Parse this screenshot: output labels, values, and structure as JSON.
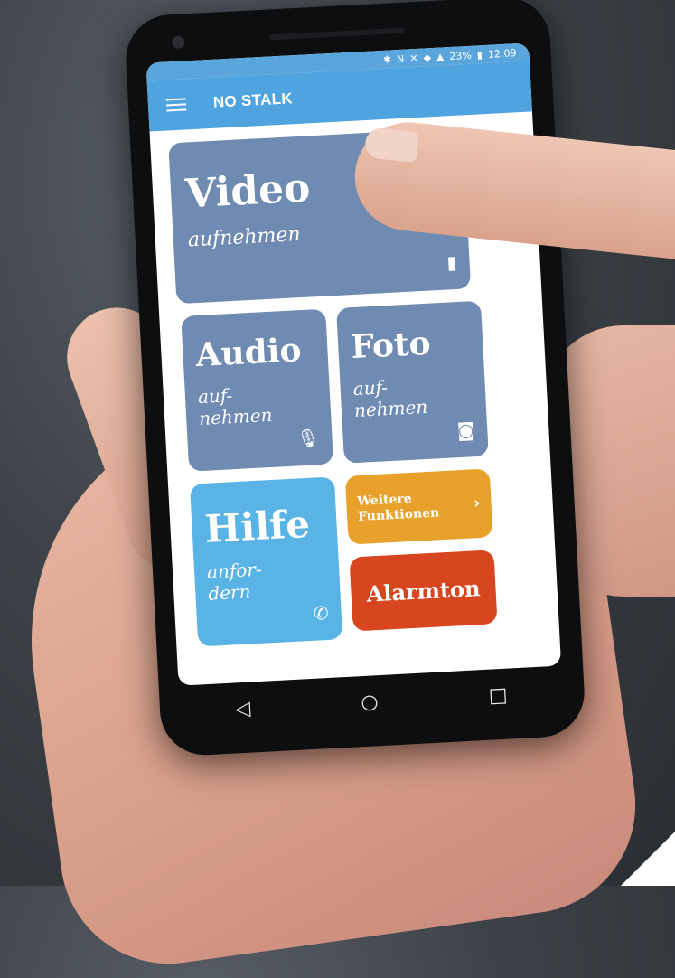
{
  "statusbar": {
    "icons": [
      "bluetooth-icon",
      "nfc-icon",
      "mute-icon",
      "wifi-icon",
      "signal-icon",
      "battery-icon"
    ],
    "battery": "23%",
    "time": "12:09"
  },
  "app": {
    "title": "NO STALK"
  },
  "tiles": {
    "video": {
      "title": "Video",
      "subtitle": "aufnehmen"
    },
    "audio": {
      "title": "Audio",
      "subtitle_line1": "auf-",
      "subtitle_line2": "nehmen"
    },
    "foto": {
      "title": "Foto",
      "subtitle_line1": "auf-",
      "subtitle_line2": "nehmen"
    },
    "hilfe": {
      "title": "Hilfe",
      "subtitle_line1": "anfor-",
      "subtitle_line2": "dern"
    },
    "weitere": {
      "line1": "Weitere",
      "line2": "Funktionen"
    },
    "alarm": {
      "label": "Alarmton"
    }
  },
  "colors": {
    "appbar": "#4fa3de",
    "tile_primary": "#6f8bb2",
    "tile_help": "#5ab3e5",
    "tile_more": "#e8a12a",
    "tile_alarm": "#d8461f"
  }
}
